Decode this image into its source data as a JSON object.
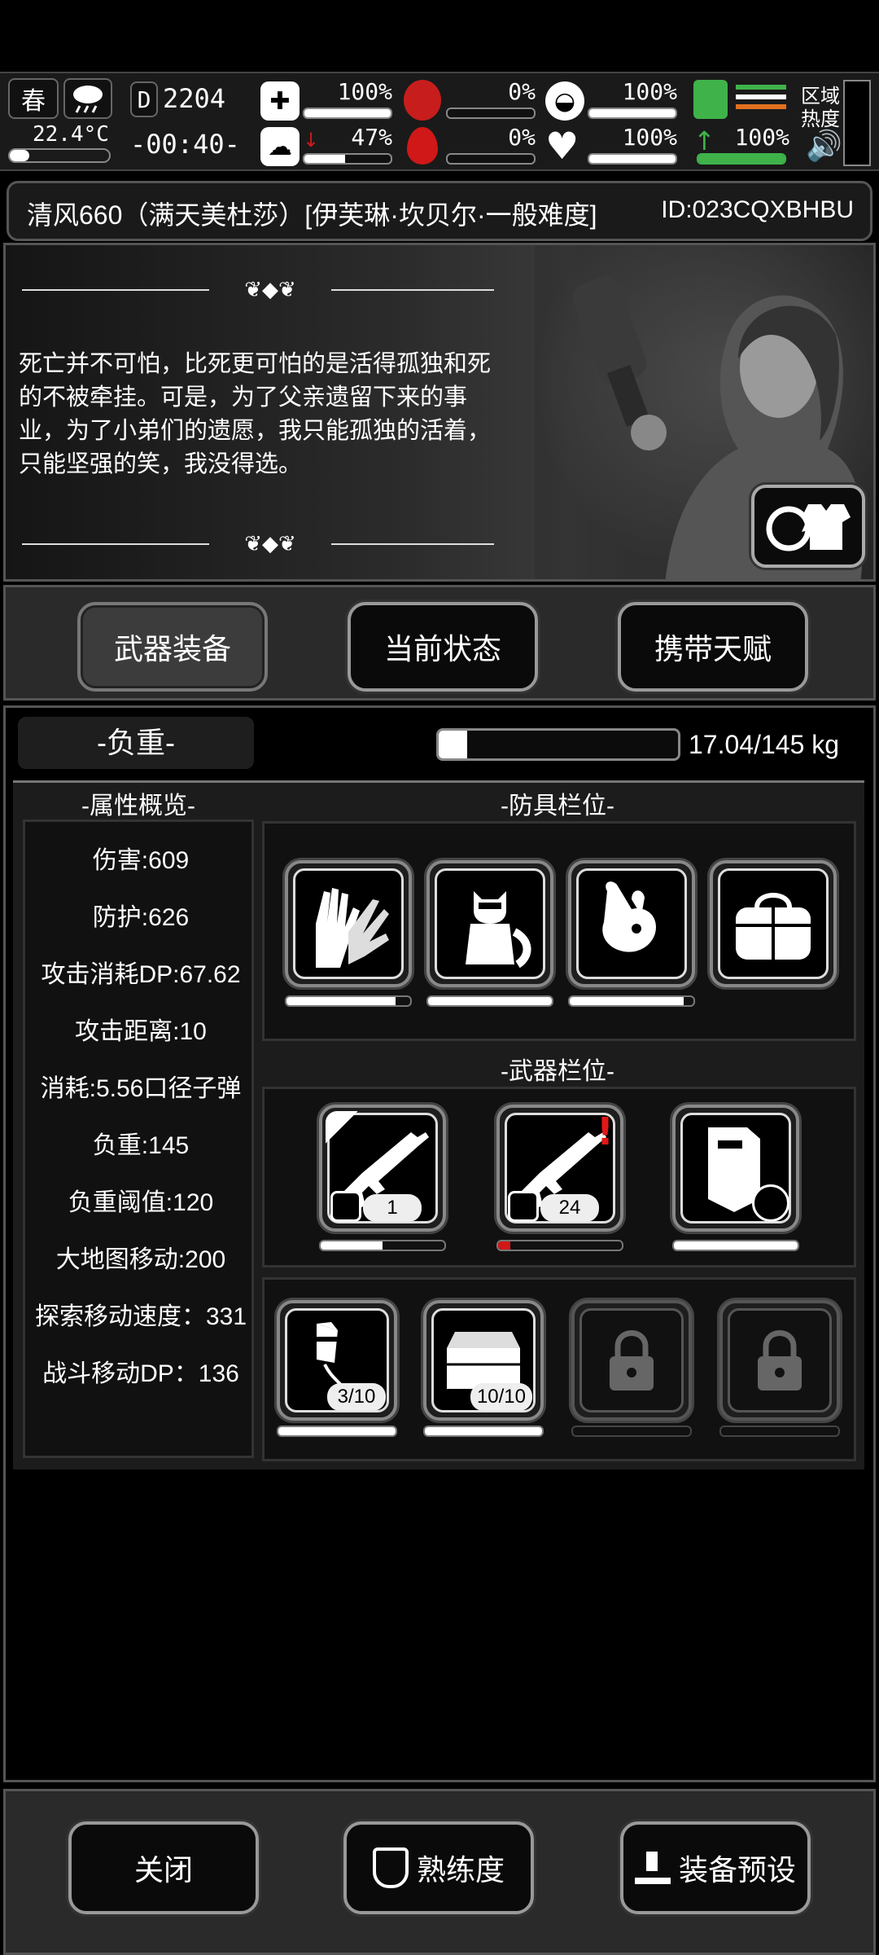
{
  "hud": {
    "season": "春",
    "temperature": "22.4°C",
    "day_counter": "2204",
    "clock": "-00:40-",
    "stats": {
      "health_pct": "100%",
      "hunger_pct": "0%",
      "shield_pct": "100%",
      "stamina_pct": "100%",
      "sanity_pct": "47%",
      "bleed_pct": "0%",
      "heart_pct": "100%",
      "run_pct": "100%"
    },
    "region_heat_label": "区域热度",
    "progress": {
      "health": 1.0,
      "hunger": 0.0,
      "shield": 1.0,
      "sanity": 0.47,
      "bleed": 0.0,
      "heart": 1.0,
      "run": 1.0
    },
    "colors": {
      "stamina": "#3fb34a",
      "orange": "#e07020",
      "blood": "#d01818"
    }
  },
  "title": {
    "text": "清风660（满天美杜莎）[伊芙琳·坎贝尔·一般难度]",
    "id": "ID:023CQXBHBU"
  },
  "story": {
    "text": "死亡并不可怕，比死更可怕的是活得孤独和死的不被牵挂。可是，为了父亲遗留下来的事业，为了小弟们的遗愿，我只能孤独的活着，只能坚强的笑，我没得选。",
    "swap_icon": "outfit-swap-icon"
  },
  "tabs": [
    "武器装备",
    "当前状态",
    "携带天赋"
  ],
  "load": {
    "label": "-负重-",
    "value": "17.04/145 kg",
    "fraction": 0.12
  },
  "attributes": {
    "title": "-属性概览-",
    "items": [
      "伤害:609",
      "防护:626",
      "攻击消耗DP:67.62",
      "攻击距离:10",
      "消耗:5.56口径子弹",
      "负重:145",
      "负重阈值:120",
      "大地图移动:200",
      "探索移动速度：331",
      "战斗移动DP：136"
    ]
  },
  "armor": {
    "title": "-防具栏位-",
    "slots": [
      {
        "icon": "gloves-icon",
        "durability": 0.88
      },
      {
        "icon": "raccoon-suit-icon",
        "durability": 1.0
      },
      {
        "icon": "rabbit-mask-icon",
        "durability": 0.92
      },
      {
        "icon": "duffel-bag-icon",
        "durability": null
      }
    ]
  },
  "weapons": {
    "title": "-武器栏位-",
    "slots": [
      {
        "icon": "assault-rifle-icon",
        "count": "1",
        "durability": 0.5
      },
      {
        "icon": "assault-rifle-icon",
        "count": "24",
        "durability": 0.1
      },
      {
        "icon": "riot-shield-icon",
        "durability": 1.0
      }
    ]
  },
  "items": {
    "slots": [
      {
        "icon": "firework-rocket-icon",
        "count": "3/10",
        "durability": 1.0
      },
      {
        "icon": "ammo-crate-icon",
        "count": "10/10",
        "durability": 1.0
      },
      {
        "icon": "lock-icon",
        "locked": true
      },
      {
        "icon": "lock-icon",
        "locked": true
      }
    ]
  },
  "bottom": {
    "close": "关闭",
    "proficiency": "熟练度",
    "preset": "装备预设"
  }
}
